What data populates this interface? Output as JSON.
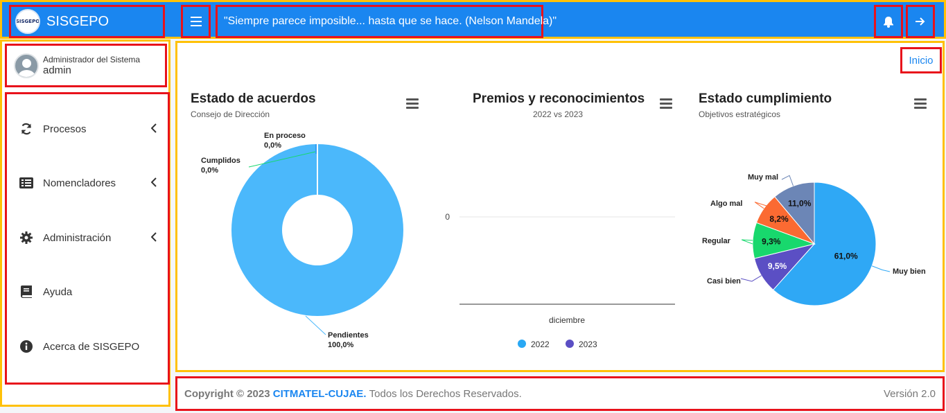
{
  "header": {
    "brand": "SISGEPO",
    "logo_text": "SISGEPO",
    "quote": "\"Siempre parece imposible... hasta que se hace. (Nelson Mandela)\""
  },
  "user": {
    "role": "Administrador del Sistema",
    "name": "admin"
  },
  "sidebar": {
    "items": [
      {
        "label": "Procesos",
        "icon": "refresh-icon",
        "has_submenu": true
      },
      {
        "label": "Nomencladores",
        "icon": "list-icon",
        "has_submenu": true
      },
      {
        "label": "Administración",
        "icon": "gear-icon",
        "has_submenu": true
      },
      {
        "label": "Ayuda",
        "icon": "book-icon",
        "has_submenu": false
      },
      {
        "label": "Acerca de SISGEPO",
        "icon": "info-icon",
        "has_submenu": false
      }
    ]
  },
  "breadcrumb": "Inicio",
  "charts": {
    "acuerdos": {
      "title": "Estado de acuerdos",
      "subtitle": "Consejo de Dirección"
    },
    "premios": {
      "title": "Premios y reconocimientos",
      "subtitle": "2022 vs 2023"
    },
    "cumplimiento": {
      "title": "Estado cumplimiento",
      "subtitle": "Objetivos estratégicos"
    }
  },
  "chart_data": [
    {
      "type": "pie",
      "title": "Estado de acuerdos",
      "subtitle": "Consejo de Dirección",
      "donut": true,
      "slices": [
        {
          "label": "Pendientes",
          "value": 100.0,
          "value_label": "100,0%",
          "color": "#4bb8fb"
        },
        {
          "label": "En proceso",
          "value": 0.0,
          "value_label": "0,0%",
          "color": "#1a86f0"
        },
        {
          "label": "Cumplidos",
          "value": 0.0,
          "value_label": "0,0%",
          "color": "#17d86f"
        }
      ]
    },
    {
      "type": "bar",
      "title": "Premios y reconocimientos",
      "subtitle": "2022 vs 2023",
      "categories": [
        "diciembre"
      ],
      "y_ticks": [
        "0"
      ],
      "series": [
        {
          "name": "2022",
          "values": [
            0
          ],
          "color": "#29a8f4"
        },
        {
          "name": "2023",
          "values": [
            0
          ],
          "color": "#5b4fc4"
        }
      ],
      "legend": "bottom"
    },
    {
      "type": "pie",
      "title": "Estado cumplimiento",
      "subtitle": "Objetivos estratégicos",
      "slices": [
        {
          "label": "Muy bien",
          "value": 61.0,
          "value_label": "61,0%",
          "color": "#2fa8f5"
        },
        {
          "label": "Casi bien",
          "value": 9.5,
          "value_label": "9,5%",
          "color": "#5b4fc4"
        },
        {
          "label": "Regular",
          "value": 9.3,
          "value_label": "9,3%",
          "color": "#18d86d"
        },
        {
          "label": "Algo mal",
          "value": 8.2,
          "value_label": "8,2%",
          "color": "#fb6a32"
        },
        {
          "label": "Muy mal",
          "value": 11.0,
          "value_label": "11,0%",
          "color": "#6c86b6"
        }
      ]
    }
  ],
  "footer": {
    "copyright": "Copyright © 2023",
    "org": "CITMATEL-CUJAE.",
    "rights": "Todos los Derechos Reservados.",
    "version": "Versión 2.0"
  }
}
